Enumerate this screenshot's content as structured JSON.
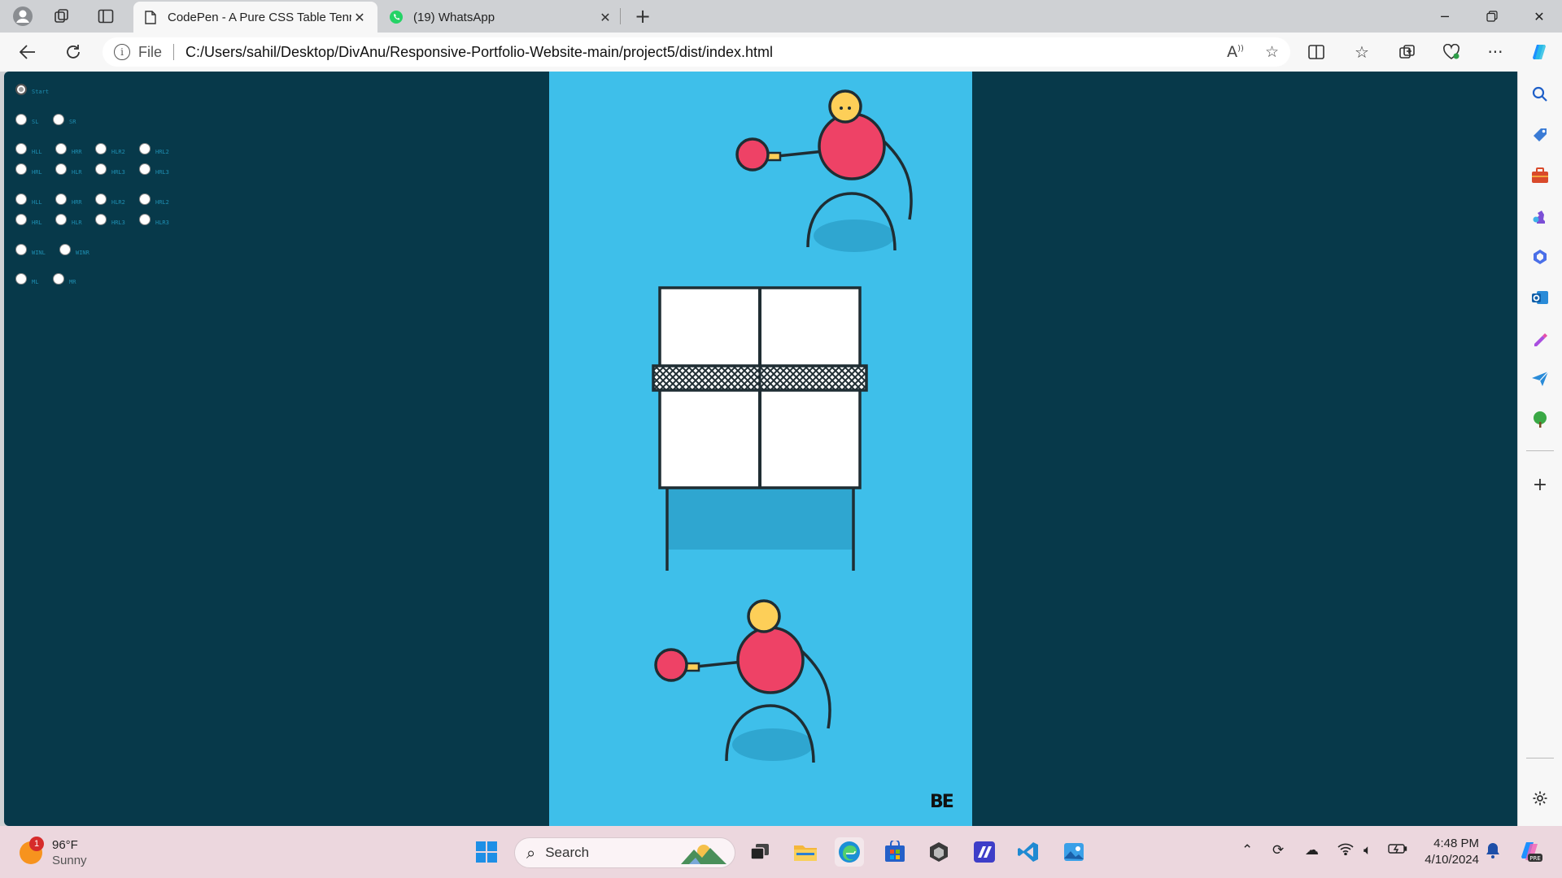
{
  "browser": {
    "tabs": [
      {
        "title": "CodePen - A Pure CSS Table Tenn",
        "active": true,
        "icon": "page-icon"
      },
      {
        "title": "(19) WhatsApp",
        "active": false,
        "icon": "whatsapp-icon"
      }
    ],
    "new_tab_label": "+",
    "address": {
      "scheme": "File",
      "url": "C:/Users/sahil/Desktop/DivAnu/Responsive-Portfolio-Website-main/project5/dist/index.html"
    }
  },
  "page": {
    "controls": [
      {
        "label": "Start",
        "checked": true
      },
      {
        "label": "SL"
      },
      {
        "label": "SR"
      },
      {
        "label": "HLL"
      },
      {
        "label": "HRR"
      },
      {
        "label": "HLR2"
      },
      {
        "label": "HRL2"
      },
      {
        "label": "HRL"
      },
      {
        "label": "HLR"
      },
      {
        "label": "HRL3"
      },
      {
        "label": "HRL3"
      },
      {
        "label": "HLL"
      },
      {
        "label": "HRR"
      },
      {
        "label": "HLR2"
      },
      {
        "label": "HRL2"
      },
      {
        "label": "HRL"
      },
      {
        "label": "HLR"
      },
      {
        "label": "HRL3"
      },
      {
        "label": "HLR3"
      },
      {
        "label": "WINL"
      },
      {
        "label": "WINR"
      },
      {
        "label": "ML"
      },
      {
        "label": "MR"
      }
    ],
    "logo_text": "BE",
    "colors": {
      "background": "#07394a",
      "court": "#3ebfea",
      "player_body": "#ee4266",
      "player_head": "#fdcf58"
    }
  },
  "taskbar": {
    "weather": {
      "temp": "96°F",
      "condition": "Sunny",
      "alert_count": "1"
    },
    "search_placeholder": "Search",
    "time": "4:48 PM",
    "date": "4/10/2024"
  }
}
